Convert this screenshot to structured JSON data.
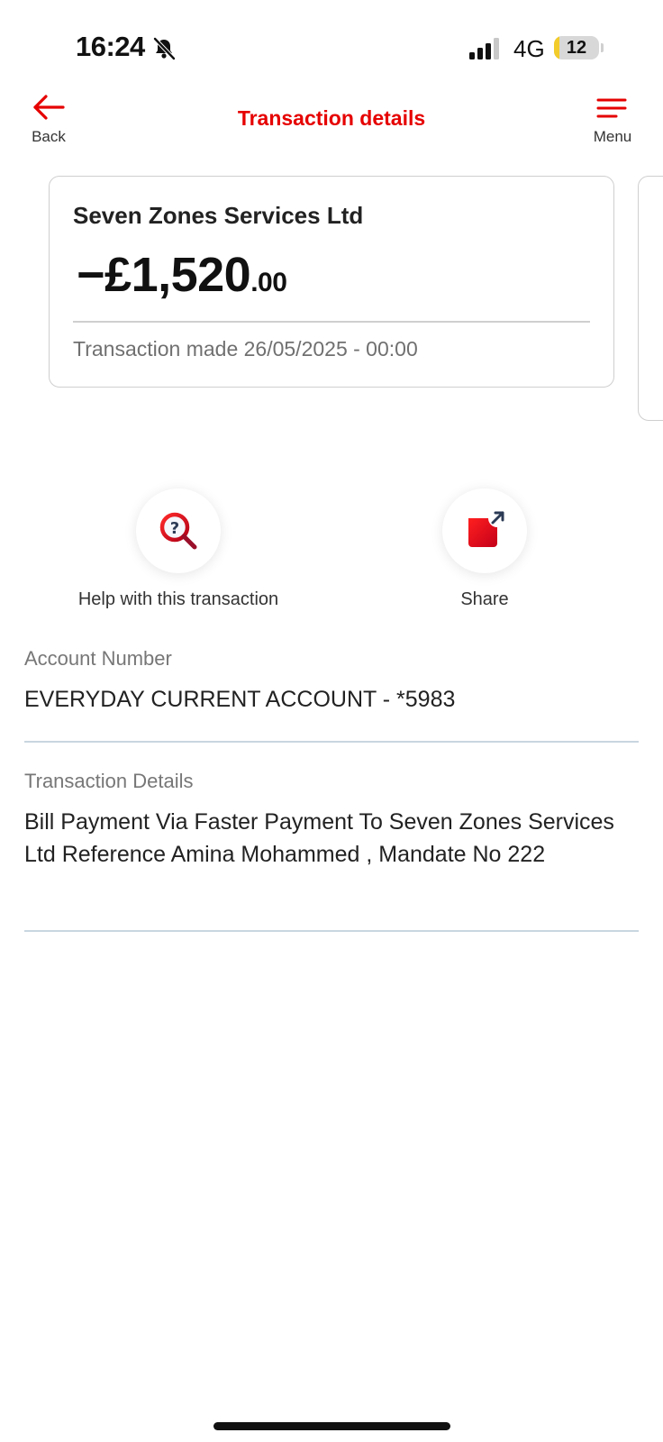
{
  "status_bar": {
    "time": "16:24",
    "network": "4G",
    "battery": "12",
    "battery_level_percent": 12
  },
  "header": {
    "back_label": "Back",
    "title": "Transaction details",
    "menu_label": "Menu"
  },
  "transaction": {
    "merchant": "Seven Zones Services Ltd",
    "amount_main": "−£1,520",
    "amount_pence": ".00",
    "date_text": "Transaction made 26/05/2025 - 00:00"
  },
  "actions": {
    "help_label": "Help with this transaction",
    "share_label": "Share"
  },
  "details": {
    "account_label": "Account Number",
    "account_value": "EVERYDAY CURRENT ACCOUNT - *5983",
    "details_label": "Transaction Details",
    "details_value": "Bill Payment Via Faster Payment To Seven Zones Services Ltd Reference Amina Mohammed , Mandate No 222"
  },
  "colors": {
    "accent": "#e60000",
    "battery_fill": "#f2cc2a",
    "divider": "#c9d6e0"
  },
  "icons": {
    "back": "arrow-left-icon",
    "menu": "hamburger-menu-icon",
    "help": "magnifier-question-icon",
    "share": "share-external-icon",
    "silent": "bell-slash-icon"
  }
}
